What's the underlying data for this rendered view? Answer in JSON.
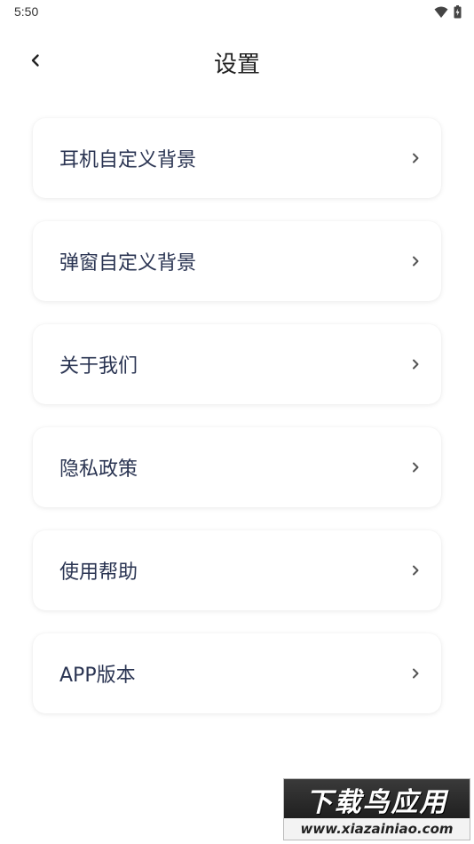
{
  "status_bar": {
    "time": "5:50",
    "icons": [
      "wifi-icon",
      "battery-charging-icon"
    ]
  },
  "header": {
    "back_icon": "chevron-left-icon",
    "title": "设置"
  },
  "menu": {
    "items": [
      {
        "label": "耳机自定义背景",
        "icon": "chevron-right-icon"
      },
      {
        "label": "弹窗自定义背景",
        "icon": "chevron-right-icon"
      },
      {
        "label": "关于我们",
        "icon": "chevron-right-icon"
      },
      {
        "label": "隐私政策",
        "icon": "chevron-right-icon"
      },
      {
        "label": "使用帮助",
        "icon": "chevron-right-icon"
      },
      {
        "label": "APP版本",
        "icon": "chevron-right-icon"
      }
    ]
  },
  "watermark": {
    "logo_text": "下载鸟应用",
    "url": "www.xiazainiao.com"
  },
  "colors": {
    "background": "#ffffff",
    "title_text": "#222222",
    "item_text": "#2a3452",
    "chevron": "#555555"
  }
}
